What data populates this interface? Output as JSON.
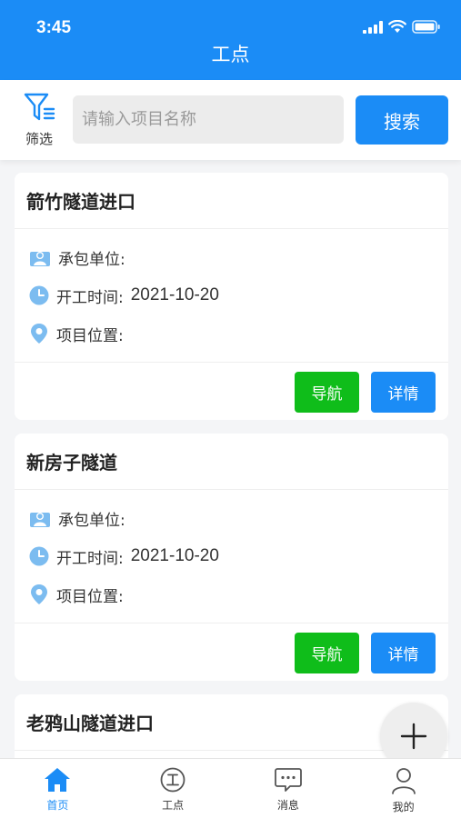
{
  "status_bar": {
    "time": "3:45"
  },
  "header": {
    "title": "工点"
  },
  "search": {
    "filter_label": "筛选",
    "placeholder": "请输入项目名称",
    "button_label": "搜索"
  },
  "labels": {
    "contractor": "承包单位:",
    "start_time": "开工时间:",
    "location": "项目位置:"
  },
  "projects": [
    {
      "name": "箭竹隧道进口",
      "contractor": "",
      "start_time": "2021-10-20",
      "location": "",
      "nav_label": "导航",
      "detail_label": "详情"
    },
    {
      "name": "新房子隧道",
      "contractor": "",
      "start_time": "2021-10-20",
      "location": "",
      "nav_label": "导航",
      "detail_label": "详情"
    },
    {
      "name": "老鸦山隧道进口"
    }
  ],
  "fab": {
    "icon": "plus-icon"
  },
  "tabbar": {
    "items": [
      {
        "label": "首页",
        "icon": "home-icon",
        "active": true
      },
      {
        "label": "工点",
        "icon": "site-icon",
        "active": false
      },
      {
        "label": "消息",
        "icon": "message-icon",
        "active": false
      },
      {
        "label": "我的",
        "icon": "user-icon",
        "active": false
      }
    ]
  },
  "colors": {
    "primary": "#1b8cf6",
    "nav_button": "#0fbd1a",
    "icon_blue": "#7cbcf0"
  }
}
